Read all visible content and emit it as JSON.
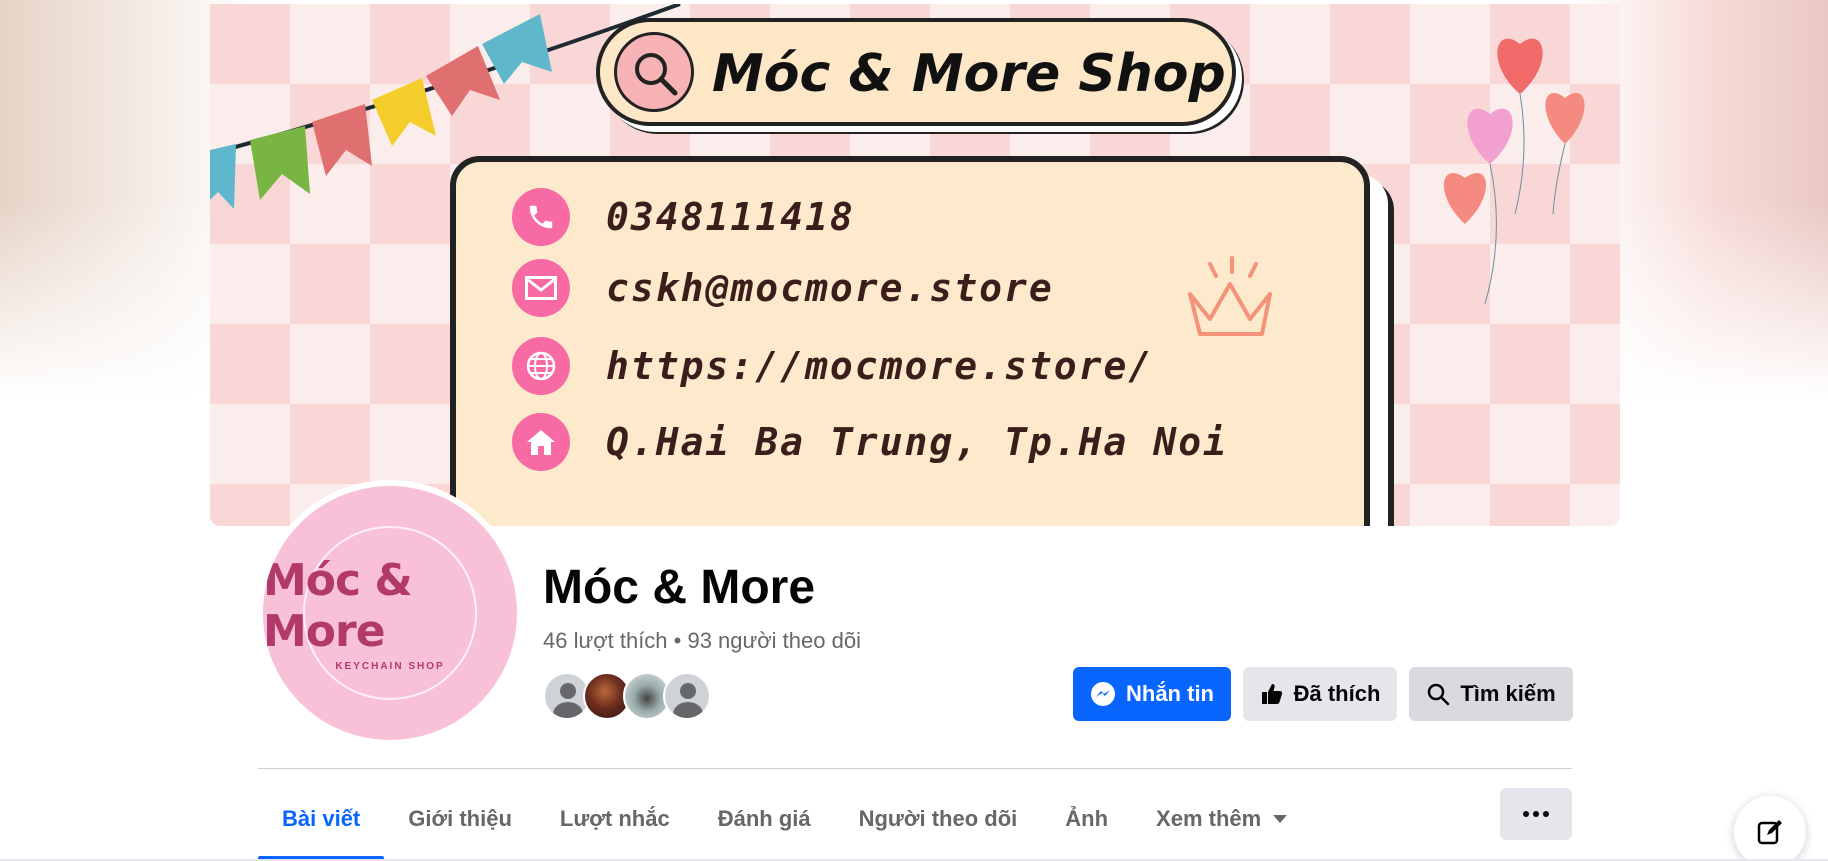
{
  "cover": {
    "shop_title": "Móc & More Shop",
    "contacts": [
      {
        "icon": "phone-icon",
        "text": "0348111418"
      },
      {
        "icon": "mail-icon",
        "text": "cskh@mocmore.store"
      },
      {
        "icon": "globe-icon",
        "text": "https://mocmore.store/"
      },
      {
        "icon": "home-icon",
        "text": "Q.Hai Ba Trung, Tp.Ha Noi"
      }
    ]
  },
  "avatar": {
    "logo": "Móc & More",
    "subtitle": "KEYCHAIN SHOP"
  },
  "profile": {
    "name": "Móc & More",
    "stats": "46 lượt thích • 93 người theo dõi"
  },
  "actions": {
    "message": "Nhắn tin",
    "liked": "Đã thích",
    "search": "Tìm kiếm"
  },
  "tabs": [
    {
      "label": "Bài viết",
      "active": true
    },
    {
      "label": "Giới thiệu"
    },
    {
      "label": "Lượt nhắc"
    },
    {
      "label": "Đánh giá"
    },
    {
      "label": "Người theo dõi"
    },
    {
      "label": "Ảnh"
    },
    {
      "label": "Xem thêm"
    }
  ],
  "colors": {
    "primary": "#0866ff",
    "secondary_bg": "#e4e6eb",
    "text_secondary": "#65676b"
  }
}
